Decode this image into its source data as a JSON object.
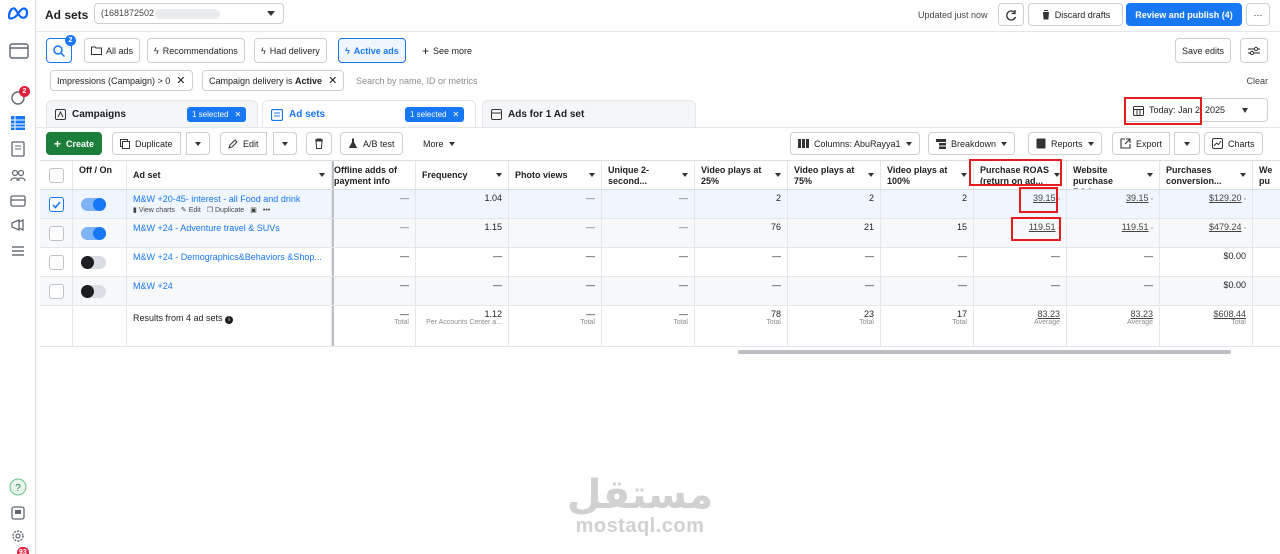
{
  "header": {
    "title": "Ad sets",
    "account_id": "(1681872502",
    "updated": "Updated just now",
    "discard_label": "Discard drafts",
    "review_label": "Review and publish (4)",
    "more_label": "···"
  },
  "rail": {
    "notif_badge": "2",
    "bottom_badge": "93"
  },
  "filters": {
    "search_badge": "2",
    "chips": [
      "All ads",
      "Recommendations",
      "Had delivery",
      "Active ads"
    ],
    "see_more": "See more",
    "save_edits": "Save edits",
    "applied": [
      {
        "text": "Impressions (Campaign) > 0"
      },
      {
        "text_pre": "Campaign delivery is ",
        "text_bold": "Active"
      }
    ],
    "search_placeholder": "Search by name, ID or metrics",
    "clear": "Clear"
  },
  "tabs": {
    "campaigns": "Campaigns",
    "campaigns_selected": "1 selected",
    "adsets": "Ad sets",
    "adsets_selected": "1 selected",
    "ads": "Ads for 1 Ad set",
    "date": "Today: Jan 2, 2025"
  },
  "toolbar": {
    "create": "Create",
    "duplicate": "Duplicate",
    "edit": "Edit",
    "ab_test": "A/B test",
    "more": "More",
    "columns": "Columns: AbuRayya1",
    "breakdown": "Breakdown",
    "reports": "Reports",
    "export": "Export",
    "charts": "Charts"
  },
  "table": {
    "headers": {
      "offon": "Off / On",
      "adset": "Ad set",
      "offline": "Offline adds of payment info",
      "frequency": "Frequency",
      "photo": "Photo views",
      "unique2": "Unique 2-second...",
      "vp25": "Video plays at 25%",
      "vp75": "Video plays at 75%",
      "vp100": "Video plays at 100%",
      "roas": "Purchase ROAS (return on ad...",
      "website_roas": "Website purchase ROA...",
      "purch_conv": "Purchases conversion...",
      "we": "We pu"
    },
    "rows": [
      {
        "name": "M&W +20-45- interest - all Food and drink",
        "offline": "—",
        "frequency": "1.04",
        "photo": "—",
        "unique2": "—",
        "vp25": "2",
        "vp75": "2",
        "vp100": "2",
        "roas": "39.15",
        "website_roas": "39.15",
        "purch_conv": "$129.20",
        "selected": true,
        "on": true
      },
      {
        "name": "M&W +24 - Adventure travel & SUVs",
        "offline": "—",
        "frequency": "1.15",
        "photo": "—",
        "unique2": "—",
        "vp25": "76",
        "vp75": "21",
        "vp100": "15",
        "roas": "119.51",
        "website_roas": "119.51",
        "purch_conv": "$479.24",
        "selected": false,
        "on": true
      },
      {
        "name": "M&W +24 - Demographics&Behaviors &Shop...",
        "offline": "—",
        "frequency": "—",
        "photo": "—",
        "unique2": "—",
        "vp25": "—",
        "vp75": "—",
        "vp100": "—",
        "roas": "—",
        "website_roas": "—",
        "purch_conv": "$0.00",
        "selected": false,
        "on": false
      },
      {
        "name": "M&W +24",
        "offline": "—",
        "frequency": "—",
        "photo": "—",
        "unique2": "—",
        "vp25": "—",
        "vp75": "—",
        "vp100": "—",
        "roas": "—",
        "website_roas": "—",
        "purch_conv": "$0.00",
        "selected": false,
        "on": false
      }
    ],
    "row_actions": {
      "view_charts": "View charts",
      "edit": "Edit",
      "duplicate": "Duplicate",
      "more": "•••"
    },
    "totals": {
      "label": "Results from 4 ad sets",
      "offline": "—",
      "offline_sub": "Total",
      "frequency": "1.12",
      "frequency_sub": "Per Accounts Center a...",
      "photo": "—",
      "photo_sub": "Total",
      "unique2": "—",
      "unique2_sub": "Total",
      "vp25": "78",
      "vp25_sub": "Total",
      "vp75": "23",
      "vp75_sub": "Total",
      "vp100": "17",
      "vp100_sub": "Total",
      "roas": "83.23",
      "roas_sub": "Average",
      "website_roas": "83.23",
      "website_roas_sub": "Average",
      "purch_conv": "$608.44",
      "purch_conv_sub": "Total"
    }
  },
  "watermark": {
    "arabic": "مستقل",
    "latin": "mostaql.com"
  },
  "colors": {
    "accent": "#1877f2",
    "create": "#1b7f3a",
    "highlight": "#e41e1e"
  }
}
